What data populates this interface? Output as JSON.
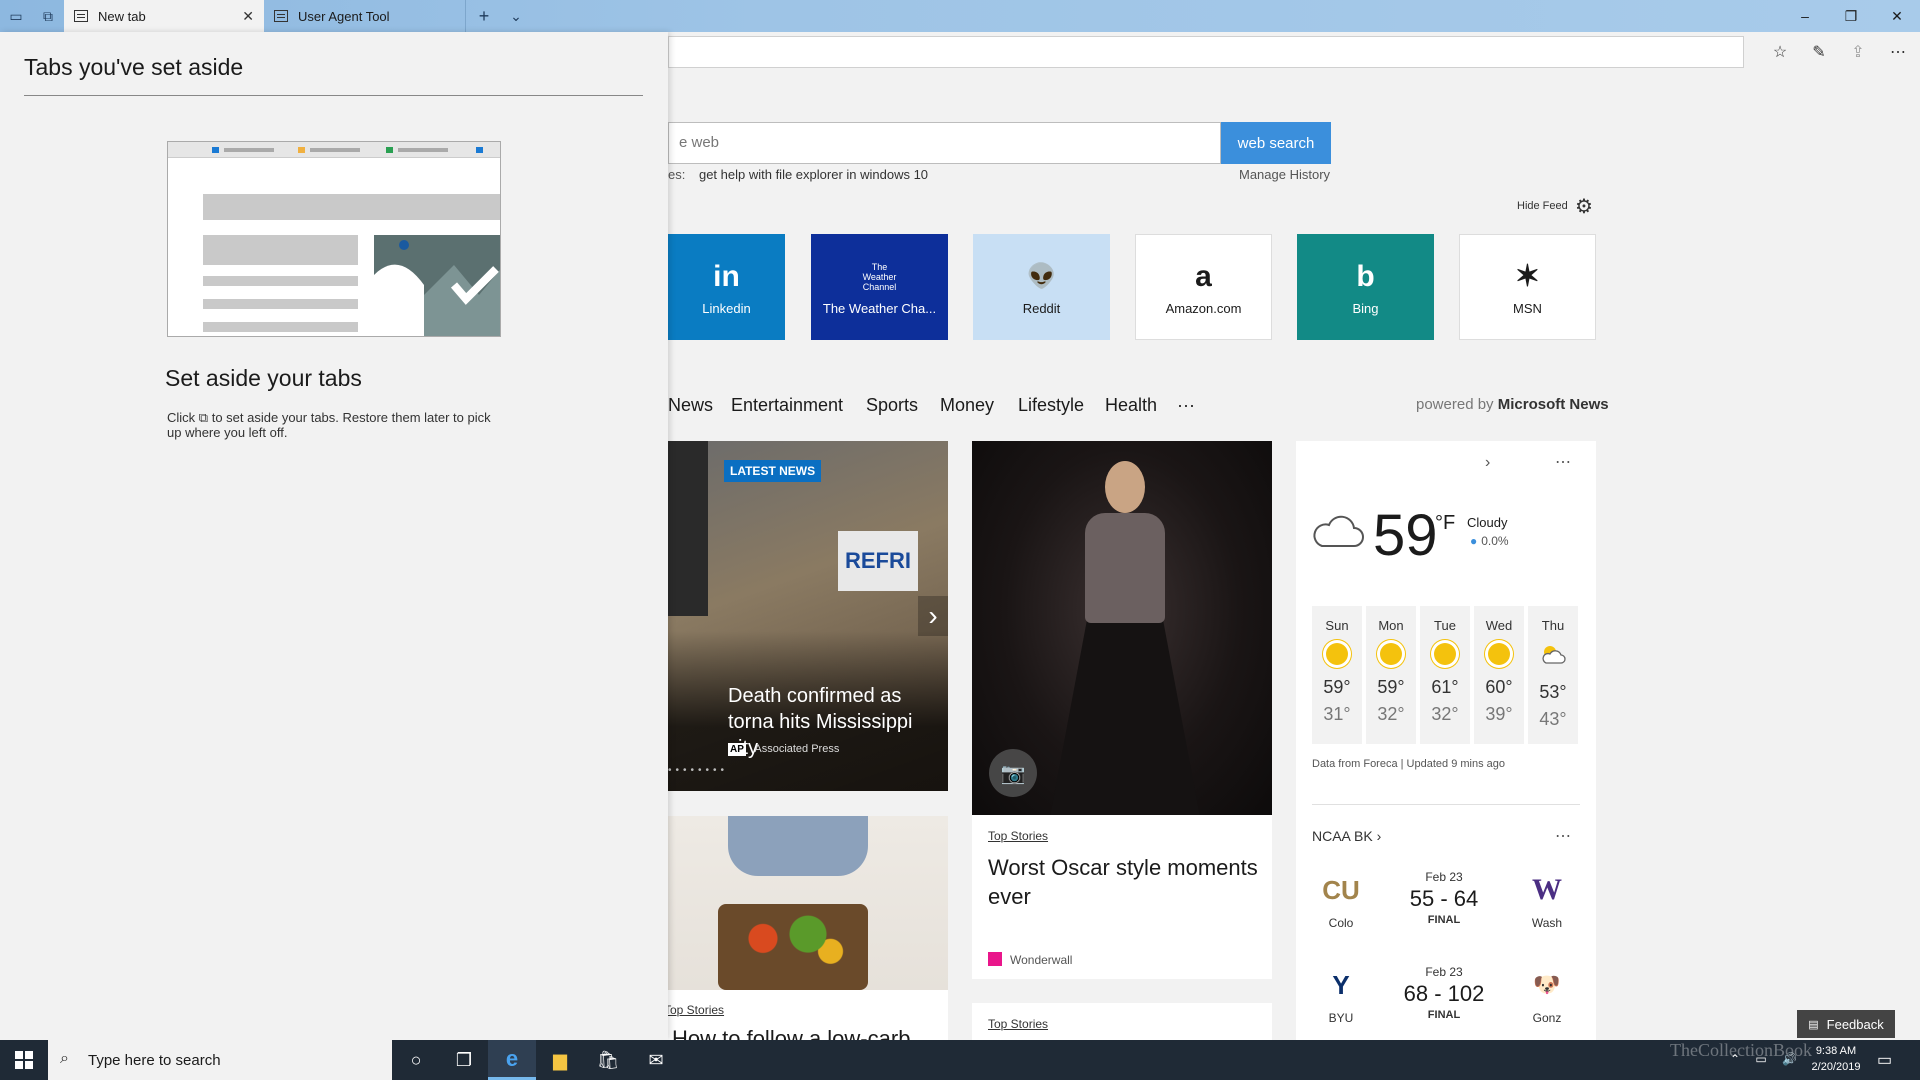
{
  "browser": {
    "tabs": [
      {
        "label": "New tab"
      },
      {
        "label": "User Agent Tool"
      }
    ],
    "window_controls": {
      "minimize": "–",
      "maximize": "❐",
      "close": "✕"
    }
  },
  "newtab": {
    "search_placeholder_visible": "e web",
    "search_button": "web search",
    "trending_label": "es:",
    "trending_query": "get help with file explorer in windows 10",
    "manage_history": "Manage History",
    "hide_feed": "Hide Feed",
    "top_sites": [
      {
        "label": "Linkedin",
        "glyph": "in",
        "color": "#0a7cc2"
      },
      {
        "label": "The Weather Cha...",
        "glyph": "The Weather Channel",
        "color": "#0d2f9a"
      },
      {
        "label": "Reddit",
        "glyph": "👽",
        "color": "#c8dff4"
      },
      {
        "label": "Amazon.com",
        "glyph": "a",
        "color": "#ffffff"
      },
      {
        "label": "Bing",
        "glyph": "b",
        "color": "#128a86"
      },
      {
        "label": "MSN",
        "glyph": "✶",
        "color": "#ffffff"
      }
    ],
    "categories": [
      "News",
      "Entertainment",
      "Sports",
      "Money",
      "Lifestyle",
      "Health",
      "···"
    ],
    "powered_by_prefix": "powered by",
    "powered_by_brand": "Microsoft News"
  },
  "cards": {
    "latest": {
      "badge": "LATEST NEWS",
      "sign_text": "REFRI",
      "headline": "Death confirmed as torna hits Mississippi city",
      "source_logo": "AP",
      "source": "Associated Press",
      "arrow": "›",
      "dots": "••••••••"
    },
    "oscar": {
      "category": "Top Stories",
      "title": "Worst Oscar style moments ever",
      "source": "Wonderwall"
    },
    "lowcarb": {
      "category": "Top Stories",
      "title": "How to follow a low-carb"
    },
    "fourth": {
      "category": "Top Stories"
    }
  },
  "weather": {
    "temp": "59",
    "unit": "°F",
    "condition": "Cloudy",
    "precip": "0.0%",
    "forecast": [
      {
        "day": "Sun",
        "hi": "59°",
        "lo": "31°",
        "icon": "sunny"
      },
      {
        "day": "Mon",
        "hi": "59°",
        "lo": "32°",
        "icon": "sunny"
      },
      {
        "day": "Tue",
        "hi": "61°",
        "lo": "32°",
        "icon": "sunny"
      },
      {
        "day": "Wed",
        "hi": "60°",
        "lo": "39°",
        "icon": "sunny"
      },
      {
        "day": "Thu",
        "hi": "53°",
        "lo": "43°",
        "icon": "partly-cloudy"
      }
    ],
    "footer": "Data from Foreca | Updated 9 mins ago"
  },
  "ncaa": {
    "title": "NCAA BK",
    "games": [
      {
        "home": "Colo",
        "home_logo": "CU",
        "away": "Wash",
        "away_logo": "W",
        "date": "Feb 23",
        "score": "55 - 64",
        "status": "FINAL"
      },
      {
        "home": "BYU",
        "home_logo": "Y",
        "away": "Gonz",
        "away_logo": "🐶",
        "date": "Feb 23",
        "score": "68 - 102",
        "status": "FINAL"
      }
    ]
  },
  "feedback": "Feedback",
  "panel": {
    "title": "Tabs you've set aside",
    "heading": "Set aside your tabs",
    "desc_before": "Click",
    "desc_after": "to set aside your tabs. Restore them later to pick up where you left off."
  },
  "taskbar": {
    "search_placeholder": "Type here to search",
    "time": "9:38 AM",
    "date": "2/20/2019",
    "watermark": "TheCollectionBook"
  }
}
